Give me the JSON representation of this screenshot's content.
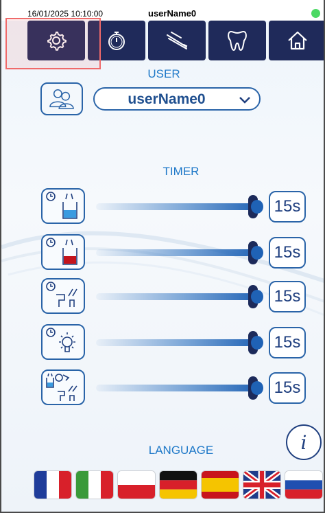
{
  "status": {
    "datetime": "16/01/2025 10:10:00",
    "username": "userName0",
    "indicator_color": "#4cd964"
  },
  "nav": {
    "items": [
      {
        "name": "settings",
        "icon": "gear-icon"
      },
      {
        "name": "timer",
        "icon": "stopwatch-icon"
      },
      {
        "name": "instruments",
        "icon": "instruments-icon"
      },
      {
        "name": "tooth",
        "icon": "tooth-icon"
      },
      {
        "name": "home",
        "icon": "home-icon"
      }
    ]
  },
  "user_section": {
    "label": "USER",
    "selected_user": "userName0"
  },
  "timer_section": {
    "label": "TIMER",
    "rows": [
      {
        "icon": "cup-blue-water-icon",
        "value": "15s",
        "level": 1.0
      },
      {
        "icon": "cup-red-water-icon",
        "value": "15s",
        "level": 1.0
      },
      {
        "icon": "bowl-rinse-icon",
        "value": "15s",
        "level": 1.0
      },
      {
        "icon": "light-bulb-icon",
        "value": "15s",
        "level": 1.0
      },
      {
        "icon": "cup-to-bowl-icon",
        "value": "15s",
        "level": 1.0
      }
    ]
  },
  "language_section": {
    "label": "LANGUAGE",
    "info_label": "i",
    "flags": [
      "french-flag",
      "italian-flag",
      "polish-flag",
      "german-flag",
      "spanish-flag",
      "uk-flag",
      "russian-flag"
    ]
  },
  "colors": {
    "nav_bg": "#1f2a5a",
    "accent": "#1e78c8",
    "border": "#2a64a8"
  }
}
